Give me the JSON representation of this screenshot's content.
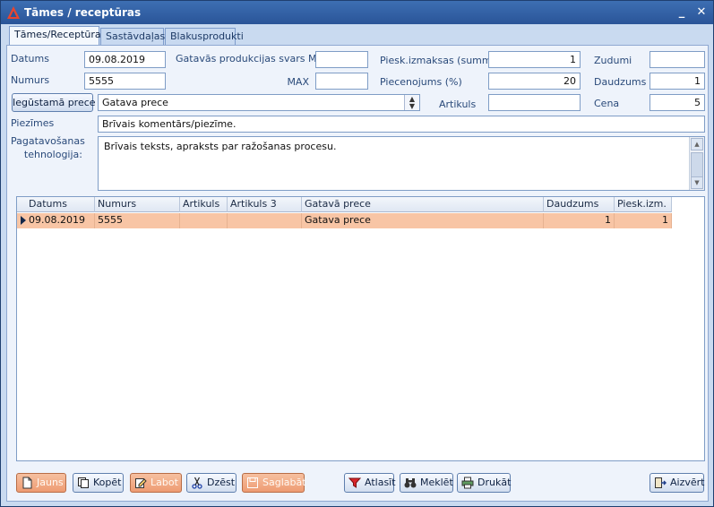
{
  "window": {
    "title": "Tāmes / receptūras",
    "minimize": "_",
    "close": "✕"
  },
  "tabs": [
    {
      "label": "Tāmes/Receptūras",
      "active": true
    },
    {
      "label": "Sastāvdaļas",
      "active": false
    },
    {
      "label": "Blakusprodukti",
      "active": false
    }
  ],
  "form": {
    "date_label": "Datums",
    "date_value": "09.08.2019",
    "number_label": "Numurs",
    "number_value": "5555",
    "weight_min_label": "Gatavās produkcijas svars MIN",
    "weight_min_value": "",
    "weight_max_label": "MAX",
    "weight_max_value": "",
    "surcharge_label": "Piesk.izmaksas (summa)",
    "surcharge_value": "1",
    "markup_label": "Piecenojums (%)",
    "markup_value": "20",
    "article_label": "Artikuls",
    "article_value": "",
    "losses_label": "Zudumi",
    "losses_value": "",
    "quantity_label": "Daudzums",
    "quantity_value": "1",
    "price_label": "Cena",
    "price_value": "5",
    "product_button": "Iegūstamā prece",
    "product_value": "Gatava prece",
    "notes_label": "Piezīmes",
    "notes_value": "Brīvais komentārs/piezīme.",
    "tech_label_1": "Pagatavošanas",
    "tech_label_2": "tehnologija:",
    "tech_value": "Brīvais teksts, apraksts par ražošanas procesu."
  },
  "grid": {
    "columns": [
      "Datums",
      "Numurs",
      "Artikuls",
      "Artikuls 3",
      "Gatavā prece",
      "Daudzums",
      "Piesk.izm."
    ],
    "rows": [
      [
        "09.08.2019",
        "5555",
        "",
        "",
        "Gatava prece",
        "1",
        "1"
      ]
    ]
  },
  "toolbar": {
    "new": "Jauns",
    "copy": "Kopēt",
    "edit": "Labot",
    "delete": "Dzēst",
    "save": "Saglabāt",
    "filter": "Atlasīt",
    "search": "Meklēt",
    "print": "Drukāt",
    "close": "Aizvērt"
  },
  "colors": {
    "selected_row": "#f8c5a5",
    "orange_button": "#ee9b72",
    "titlebar": "#2a5598"
  }
}
